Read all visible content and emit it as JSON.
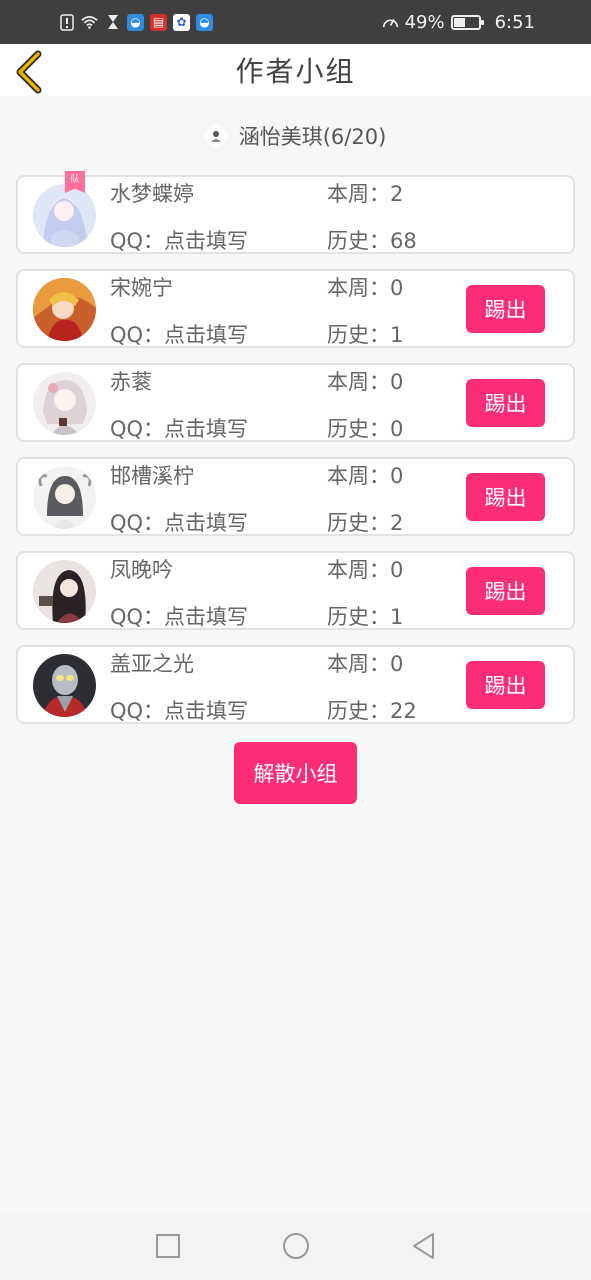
{
  "status_bar": {
    "battery_percent": "49%",
    "battery_level": 0.49,
    "time": "6:51",
    "icons": [
      "alert-icon",
      "wifi-icon",
      "hourglass-icon",
      "app-icon",
      "book-app-icon",
      "baidu-app-icon",
      "app-icon",
      "speed-icon",
      "battery-icon"
    ]
  },
  "header": {
    "title": "作者小组",
    "back_icon": "chevron-left-icon"
  },
  "group": {
    "label": "涵怡美琪(6/20)"
  },
  "members": [
    {
      "name": "水梦蝶婷",
      "qq": "QQ：点击填写",
      "week": "本周：2",
      "history": "历史：68",
      "kick": "",
      "badge": "队"
    },
    {
      "name": "宋婉宁",
      "qq": "QQ：点击填写",
      "week": "本周：0",
      "history": "历史：1",
      "kick": "踢出"
    },
    {
      "name": "赤蓘",
      "qq": "QQ：点击填写",
      "week": "本周：0",
      "history": "历史：0",
      "kick": "踢出"
    },
    {
      "name": "邯槽溪柠",
      "qq": "QQ：点击填写",
      "week": "本周：0",
      "history": "历史：2",
      "kick": "踢出"
    },
    {
      "name": "凤晚吟",
      "qq": "QQ：点击填写",
      "week": "本周：0",
      "history": "历史：1",
      "kick": "踢出"
    },
    {
      "name": "盖亚之光",
      "qq": "QQ：点击填写",
      "week": "本周：0",
      "history": "历史：22",
      "kick": "踢出"
    }
  ],
  "actions": {
    "dissolve": "解散小组"
  },
  "colors": {
    "accent": "#fb2d77",
    "status_bar": "#3f3f3f",
    "back_arrow": "#e8b400"
  }
}
